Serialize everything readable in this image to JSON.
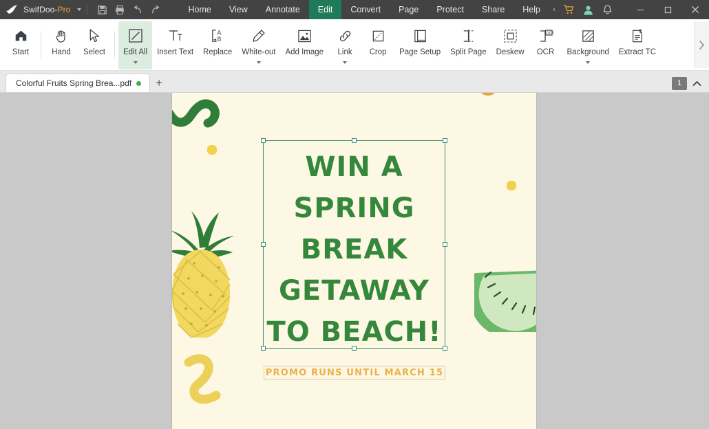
{
  "titlebar": {
    "app_name_main": "SwifDoo-",
    "app_name_suffix": "Pro",
    "quick_actions": [
      {
        "name": "save-icon",
        "label": "Save"
      },
      {
        "name": "print-icon",
        "label": "Print"
      },
      {
        "name": "undo-icon",
        "label": "Undo"
      },
      {
        "name": "redo-icon",
        "label": "Redo"
      }
    ],
    "menus": [
      {
        "label": "Home",
        "active": false
      },
      {
        "label": "View",
        "active": false
      },
      {
        "label": "Annotate",
        "active": false
      },
      {
        "label": "Edit",
        "active": true
      },
      {
        "label": "Convert",
        "active": false
      },
      {
        "label": "Page",
        "active": false
      },
      {
        "label": "Protect",
        "active": false
      },
      {
        "label": "Share",
        "active": false
      },
      {
        "label": "Help",
        "active": false
      }
    ],
    "menu_overflow": "›",
    "right_icons": [
      {
        "name": "cart-icon",
        "label": "Store",
        "color": "#e8a33d"
      },
      {
        "name": "account-icon",
        "label": "Account",
        "color": "#7fd4b0"
      },
      {
        "name": "notification-bell-icon",
        "label": "Notifications",
        "color": "#d0d0d0"
      }
    ],
    "window_controls": [
      {
        "name": "minimize-button",
        "label": "Minimize"
      },
      {
        "name": "maximize-button",
        "label": "Maximize"
      },
      {
        "name": "close-button",
        "label": "Close"
      }
    ],
    "accent_active": "#1f7a5a"
  },
  "ribbon": {
    "tools": [
      {
        "label": "Start",
        "icon": "home-icon",
        "dropdown": false,
        "active": false
      },
      {
        "label": "Hand",
        "icon": "hand-icon",
        "dropdown": false,
        "active": false
      },
      {
        "label": "Select",
        "icon": "cursor-icon",
        "dropdown": false,
        "active": false
      },
      {
        "label": "Edit All",
        "icon": "edit-all-icon",
        "dropdown": true,
        "active": true
      },
      {
        "label": "Insert Text",
        "icon": "insert-text-icon",
        "dropdown": false,
        "active": false
      },
      {
        "label": "Replace",
        "icon": "replace-icon",
        "dropdown": false,
        "active": false
      },
      {
        "label": "White-out",
        "icon": "whiteout-icon",
        "dropdown": true,
        "active": false
      },
      {
        "label": "Add Image",
        "icon": "add-image-icon",
        "dropdown": false,
        "active": false
      },
      {
        "label": "Link",
        "icon": "link-icon",
        "dropdown": true,
        "active": false
      },
      {
        "label": "Crop",
        "icon": "crop-icon",
        "dropdown": false,
        "active": false
      },
      {
        "label": "Page Setup",
        "icon": "page-setup-icon",
        "dropdown": false,
        "active": false
      },
      {
        "label": "Split Page",
        "icon": "split-page-icon",
        "dropdown": false,
        "active": false
      },
      {
        "label": "Deskew",
        "icon": "deskew-icon",
        "dropdown": false,
        "active": false
      },
      {
        "label": "OCR",
        "icon": "ocr-icon",
        "dropdown": false,
        "active": false
      },
      {
        "label": "Background",
        "icon": "background-icon",
        "dropdown": true,
        "active": false
      },
      {
        "label": "Extract TC",
        "icon": "extract-text-icon",
        "dropdown": false,
        "active": false
      }
    ],
    "scroll_more": "›",
    "active_bg": "#dcecdf"
  },
  "tabbar": {
    "document_tab": "Colorful Fruits Spring Brea...pdf",
    "modified_indicator_color": "#3bb54a",
    "new_tab": "+",
    "page_number": "1",
    "collapse": "⌃"
  },
  "document": {
    "page_bg": "#fdf8e4",
    "workspace_bg": "#c9c9c9",
    "headline_color": "#35873b",
    "headline_lines": [
      "WIN A",
      "SPRING",
      "BREAK",
      "GETAWAY",
      "TO BEACH!"
    ],
    "promo_text": "PROMO RUNS UNTIL MARCH 15",
    "promo_color": "#eab14a",
    "selection_border_color": "#3f8d73",
    "decorations": [
      {
        "name": "green-squiggle-top-left",
        "color": "#2f7d38"
      },
      {
        "name": "yellow-dot-left",
        "color": "#f2d14e"
      },
      {
        "name": "yellow-dot-right",
        "color": "#f2d14e"
      },
      {
        "name": "pineapple-illustration",
        "body_color": "#f2d85f",
        "leaf_color": "#2f7d38"
      },
      {
        "name": "kiwi-slice-illustration",
        "rind_color": "#d9543a",
        "flesh_color": "#cfe8c0"
      },
      {
        "name": "yellow-squiggle-bottom-left",
        "color": "#edd05a"
      },
      {
        "name": "orange-accent-top",
        "color": "#e8a33d"
      }
    ]
  }
}
